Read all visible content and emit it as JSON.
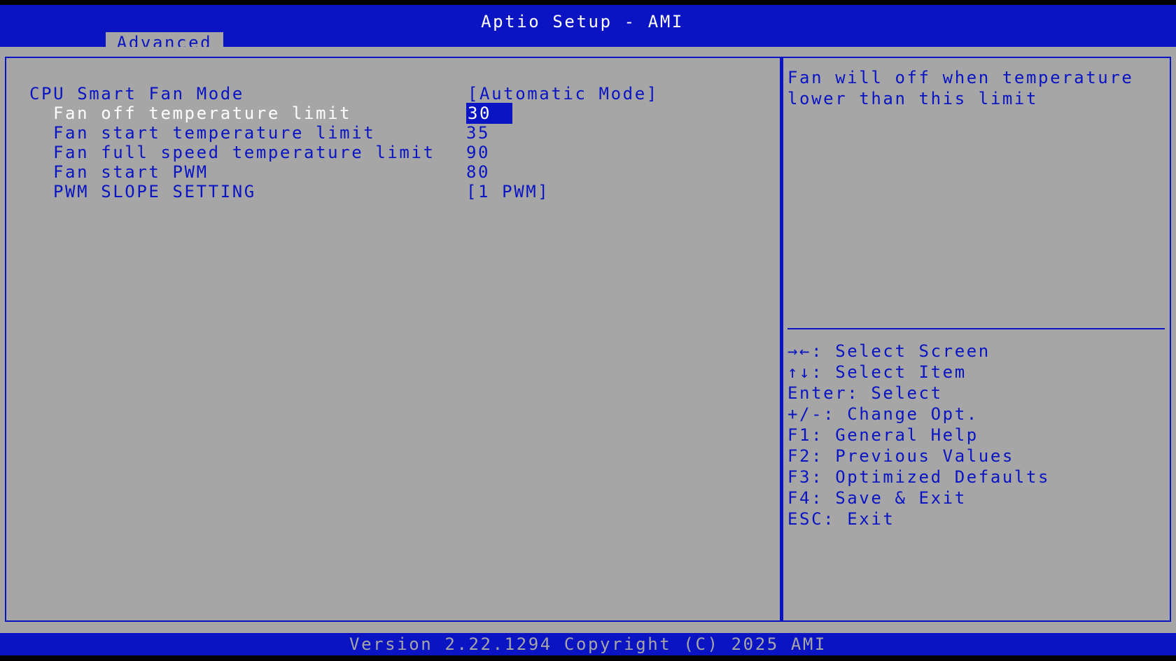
{
  "header": {
    "title": "Aptio Setup - AMI",
    "active_tab": "Advanced"
  },
  "settings": [
    {
      "label": "CPU Smart Fan Mode",
      "value": "[Automatic Mode]"
    },
    {
      "label": "Fan off temperature limit",
      "value": "30"
    },
    {
      "label": "Fan start temperature limit",
      "value": "35"
    },
    {
      "label": "Fan full speed temperature limit",
      "value": "90"
    },
    {
      "label": "Fan start PWM",
      "value": "80"
    },
    {
      "label": "PWM SLOPE SETTING",
      "value": "[1 PWM]"
    }
  ],
  "help": {
    "text": "Fan will off when temperature\nlower than this limit"
  },
  "keys": [
    "→←: Select Screen",
    "↑↓: Select Item",
    "Enter: Select",
    "+/-: Change Opt.",
    "F1: General Help",
    "F2: Previous Values",
    "F3: Optimized Defaults",
    "F4: Save & Exit",
    "ESC: Exit"
  ],
  "footer": {
    "text": "Version 2.22.1294 Copyright (C) 2025 AMI"
  },
  "colors": {
    "bios_blue": "#0a14c2",
    "panel_gray": "#a6a6a6",
    "highlight_text": "#ffffff"
  }
}
